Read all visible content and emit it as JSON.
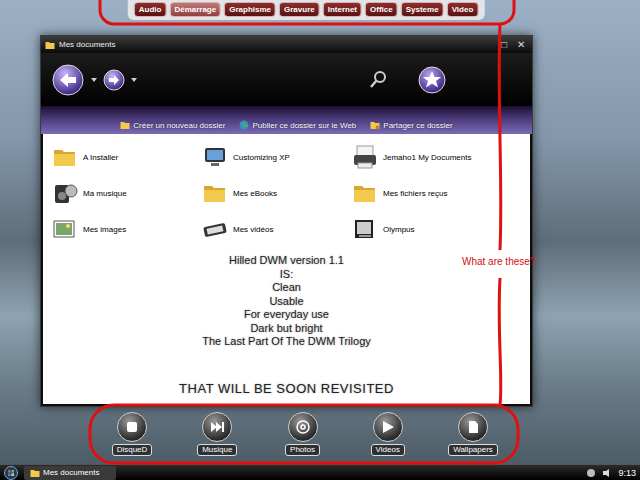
{
  "launcher": {
    "buttons": [
      {
        "label": "Audio",
        "selected": false
      },
      {
        "label": "Démarrage",
        "selected": true
      },
      {
        "label": "Graphisme",
        "selected": false
      },
      {
        "label": "Gravure",
        "selected": false
      },
      {
        "label": "Internet",
        "selected": false
      },
      {
        "label": "Office",
        "selected": false
      },
      {
        "label": "Systeme",
        "selected": false
      },
      {
        "label": "Video",
        "selected": false
      }
    ]
  },
  "window": {
    "title": "Mes documents",
    "controls": [
      "□",
      "✕"
    ]
  },
  "tasks": [
    {
      "label": "Créer un nouveau dossier",
      "kind": "folder"
    },
    {
      "label": "Publier ce dossier sur le Web",
      "kind": "globe"
    },
    {
      "label": "Partager ce dossier",
      "kind": "share"
    }
  ],
  "folders": [
    {
      "name": "A Installer",
      "kind": "folder"
    },
    {
      "name": "Customizing XP",
      "kind": "app"
    },
    {
      "name": "Jemaho1 My Documents",
      "kind": "documents"
    },
    {
      "name": "Ma musique",
      "kind": "music"
    },
    {
      "name": "Mes eBooks",
      "kind": "folder"
    },
    {
      "name": "Mes fichiers reçus",
      "kind": "folder"
    },
    {
      "name": "Mes images",
      "kind": "pictures"
    },
    {
      "name": "Mes vidéos",
      "kind": "videos"
    },
    {
      "name": "Olympus",
      "kind": "camera"
    }
  ],
  "overlay": {
    "lines": [
      "Hilled DWM version 1.1",
      "IS:",
      "Clean",
      "Usable",
      "For everyday use",
      "Dark but bright",
      "The Last Part Of The DWM Trilogy"
    ],
    "footer": "THAT WILL BE SOON REVISITED"
  },
  "dock": [
    {
      "label": "DisqueD",
      "kind": "stop"
    },
    {
      "label": "Musique",
      "kind": "skip"
    },
    {
      "label": "Photos",
      "kind": "disc"
    },
    {
      "label": "Videos",
      "kind": "play"
    },
    {
      "label": "Wallpapers",
      "kind": "page"
    }
  ],
  "taskbar": {
    "tasks": [
      {
        "label": "Mes documents",
        "selected": true
      }
    ],
    "clock": "9:13"
  },
  "annotation": {
    "text": "What are these?"
  }
}
